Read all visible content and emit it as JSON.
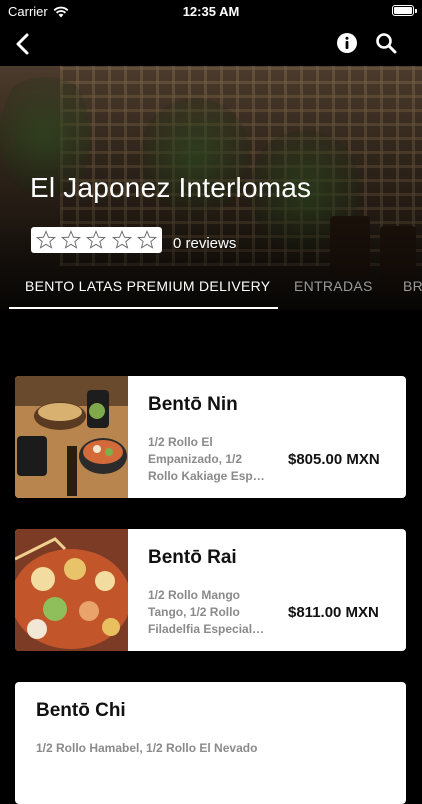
{
  "status_bar": {
    "carrier": "Carrier",
    "time": "12:35 AM"
  },
  "restaurant": {
    "name": "El Japonez Interlomas",
    "rating_stars": 0,
    "reviews_label": "0 reviews"
  },
  "tabs": [
    {
      "label": "BENTO LATAS PREMIUM DELIVERY",
      "active": true
    },
    {
      "label": "ENTRADAS",
      "active": false
    },
    {
      "label": "BR",
      "active": false
    }
  ],
  "menu_items": [
    {
      "title": "Bentō Nin",
      "description": "1/2 Rollo El Empanizado, 1/2 Rollo Kakiage Esp…",
      "price": "$805.00 MXN"
    },
    {
      "title": "Bentō Rai",
      "description": "1/2 Rollo Mango Tango, 1/2 Rollo Filadelfia Especial…",
      "price": "$811.00 MXN"
    },
    {
      "title": "Bentō Chi",
      "description": "1/2 Rollo Hamabel, 1/2 Rollo El Nevado",
      "price": ""
    }
  ],
  "icons": {
    "back": "chevron-left-icon",
    "info": "info-icon",
    "search": "search-icon",
    "wifi": "wifi-icon",
    "battery": "battery-icon",
    "star": "star-outline-icon"
  },
  "colors": {
    "background": "#000000",
    "card": "#ffffff",
    "inactive_tab": "#9a9a9a"
  }
}
